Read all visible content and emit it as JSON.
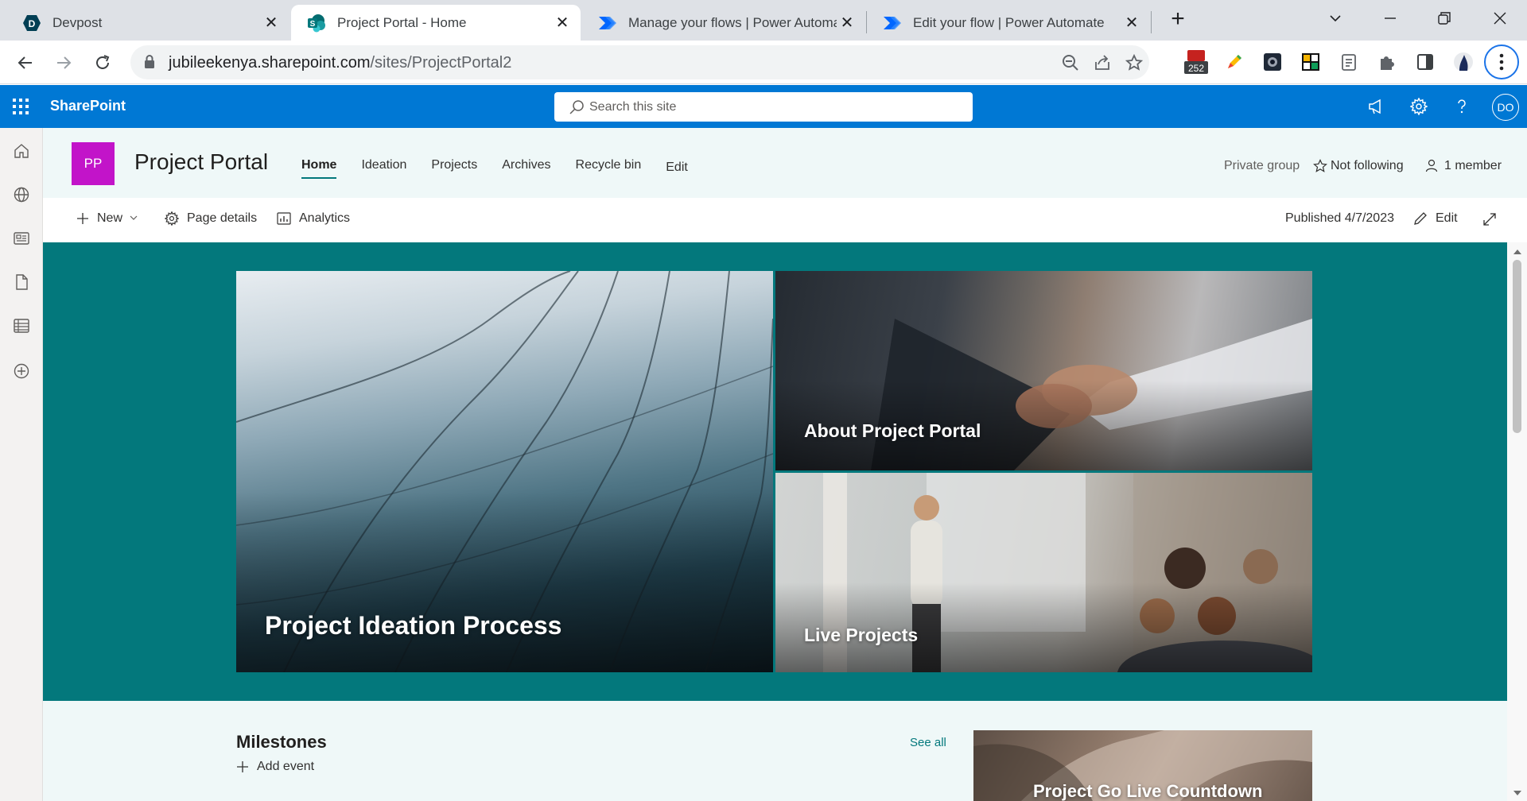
{
  "browser": {
    "tabs": [
      {
        "title": "Devpost",
        "favicon": "devpost-icon",
        "active": false
      },
      {
        "title": "Project Portal - Home",
        "favicon": "sharepoint-icon",
        "active": true
      },
      {
        "title": "Manage your flows | Power Automate",
        "favicon": "power-automate-icon",
        "active": false
      },
      {
        "title": "Edit your flow | Power Automate",
        "favicon": "power-automate-icon",
        "active": false
      }
    ],
    "url_host": "jubileekenya.sharepoint.com",
    "url_path": "/sites/ProjectPortal2",
    "extension_badge": "252"
  },
  "suite": {
    "brand": "SharePoint",
    "search_placeholder": "Search this site",
    "avatar_initials": "DO"
  },
  "site": {
    "logo_initials": "PP",
    "logo_color": "#c214c9",
    "title": "Project Portal",
    "nav": [
      "Home",
      "Ideation",
      "Projects",
      "Archives",
      "Recycle bin",
      "Edit"
    ],
    "current_nav": "Home",
    "privacy": "Private group",
    "follow_label": "Not following",
    "members_label": "1 member"
  },
  "commands": {
    "new_label": "New",
    "page_details_label": "Page details",
    "analytics_label": "Analytics",
    "published_label": "Published 4/7/2023",
    "edit_label": "Edit"
  },
  "hero": {
    "tiles": [
      {
        "label": "Project Ideation Process"
      },
      {
        "label": "About Project Portal"
      },
      {
        "label": "Live Projects"
      }
    ],
    "background_color": "#03787c"
  },
  "milestones": {
    "title": "Milestones",
    "see_all_label": "See all",
    "add_event_label": "Add event"
  },
  "countdown": {
    "label": "Project Go Live Countdown"
  },
  "colors": {
    "suite_bar": "#0078d4",
    "theme": "#03787c",
    "header_bg": "#eff8f8"
  }
}
